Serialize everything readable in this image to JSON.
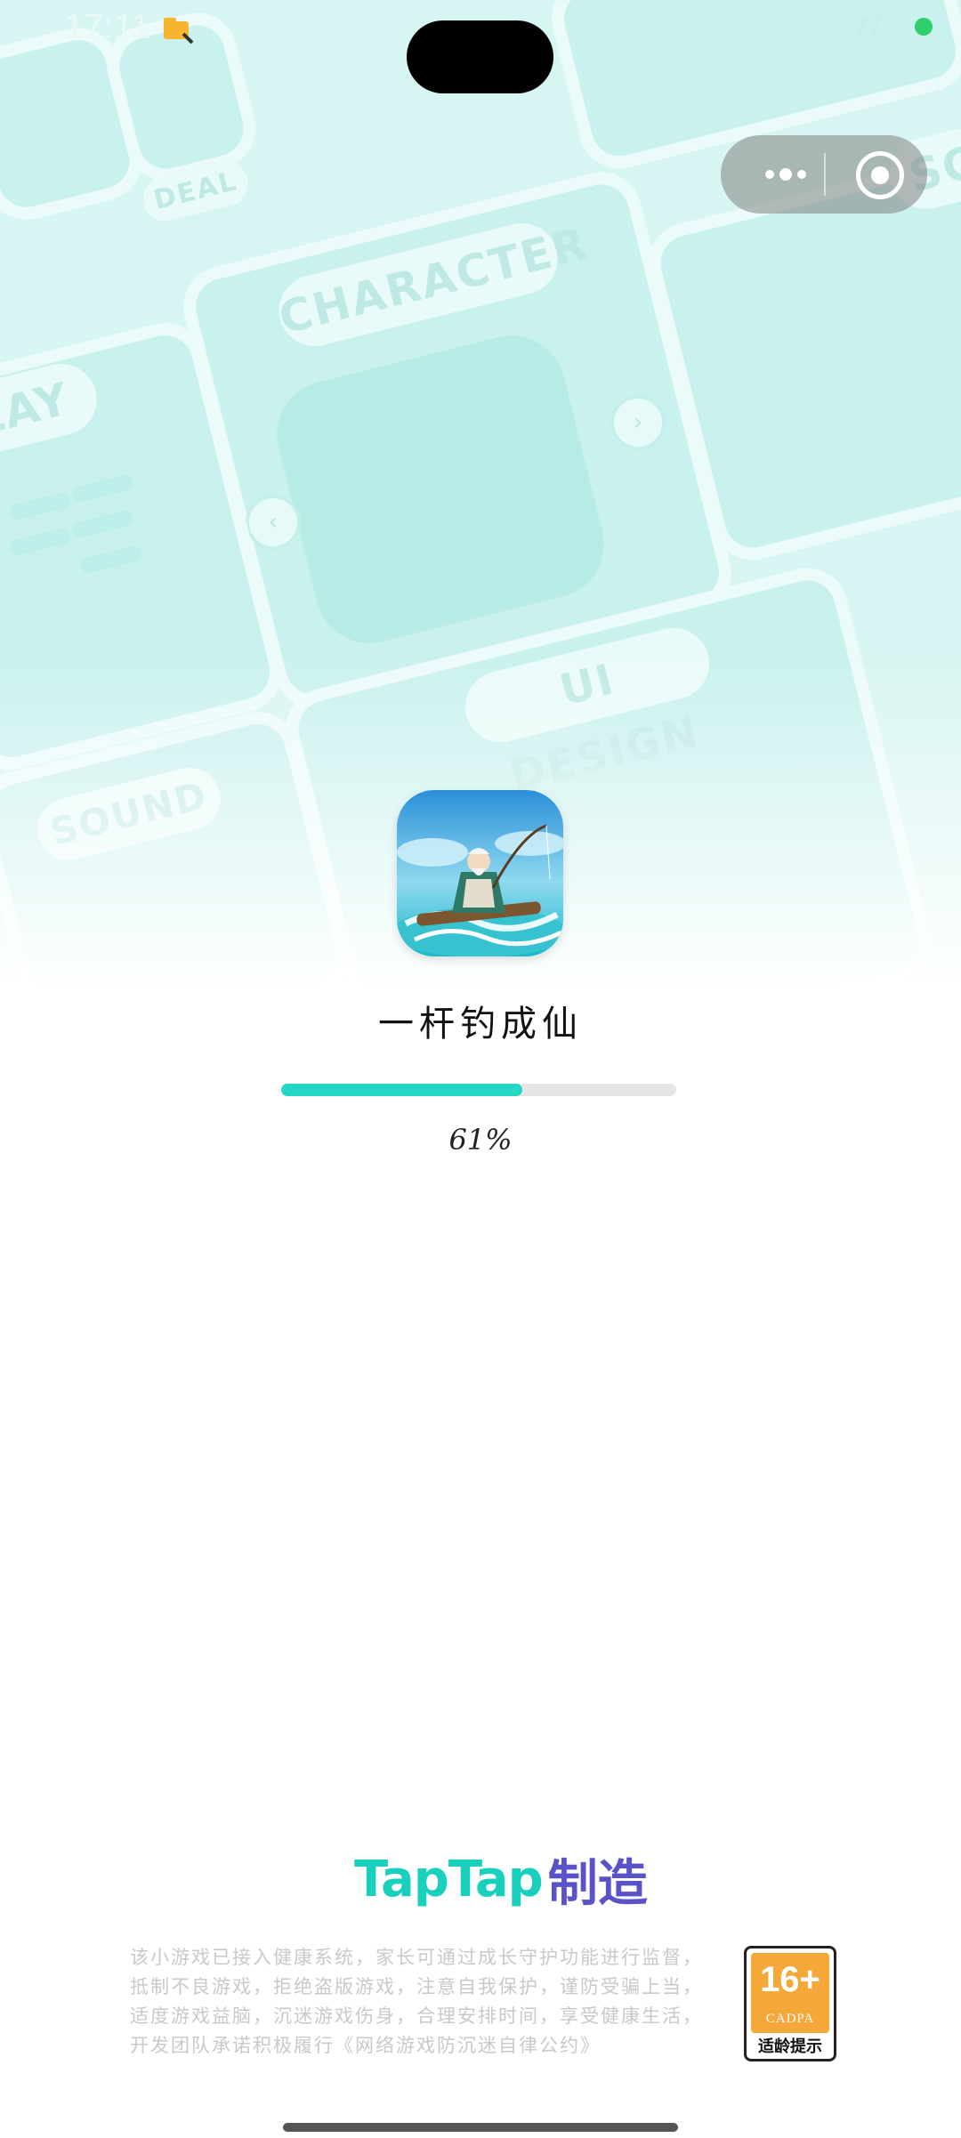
{
  "status_bar": {
    "time": "17:11",
    "right_text": "77",
    "app_icon": "folder-icon",
    "dot_color": "#2fd06b"
  },
  "background": {
    "labels": {
      "deal": "DEAL",
      "character": "CHARACTER",
      "play": "LAY",
      "ui_design": "UI DESIGN",
      "sound": "SOUND",
      "sc": "SC"
    }
  },
  "capsule": {
    "more_icon": "more-dots-icon",
    "close_icon": "target-close-icon"
  },
  "game": {
    "title": "一杆钓成仙",
    "progress_percent": 61,
    "progress_text": "61%",
    "accent_color": "#23d7c4"
  },
  "footer": {
    "logo_word": "TapTap",
    "logo_cn": "制造",
    "notice_lines": [
      "该小游戏已接入健康系统，家长可通过成长守护功能进行监督，",
      "抵制不良游戏，拒绝盗版游戏，注意自我保护，谨防受骗上当，",
      "适度游戏益脑，沉迷游戏伤身，合理安排时间，享受健康生活，",
      "开发团队承诺积极履行《网络游戏防沉迷自律公约》"
    ],
    "age_rating": {
      "number": "16+",
      "org": "CADPA",
      "label": "适龄提示"
    }
  }
}
